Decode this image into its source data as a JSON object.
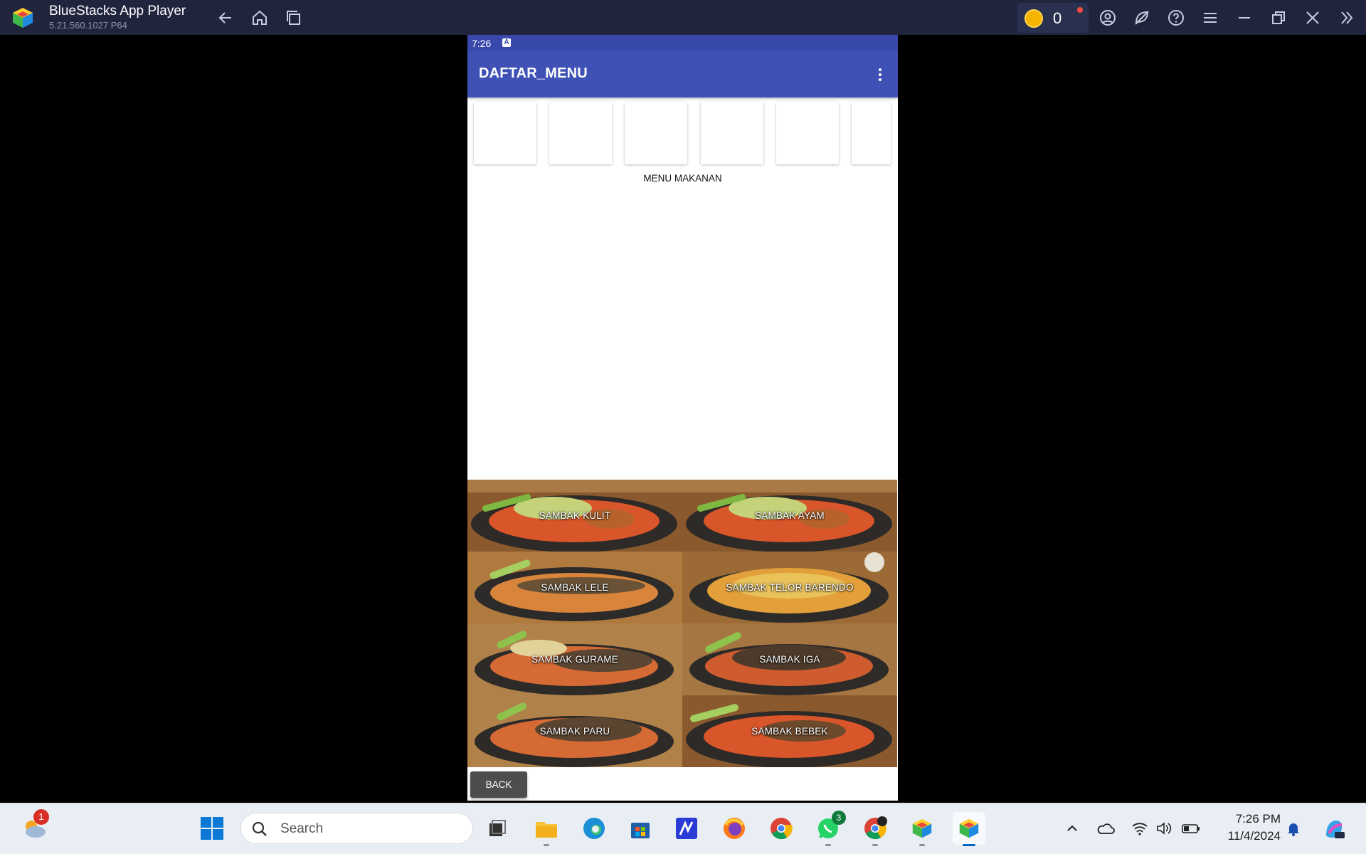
{
  "window": {
    "app_title": "BlueStacks App Player",
    "version": "5.21.560.1027  P64",
    "coin_count": "0"
  },
  "android": {
    "status_time": "7:26",
    "status_icon": "A",
    "appbar_title": "DAFTAR_MENU",
    "section_title": "MENU MAKANAN",
    "menu_items": [
      {
        "label": "SAMBAK KULIT"
      },
      {
        "label": "SAMBAK AYAM"
      },
      {
        "label": "SAMBAK LELE"
      },
      {
        "label": "SAMBAK TELOR BARENDO"
      },
      {
        "label": "SAMBAK GURAME"
      },
      {
        "label": "SAMBAK IGA"
      },
      {
        "label": "SAMBAK PARU"
      },
      {
        "label": "SAMBAK BEBEK"
      }
    ],
    "back_label": "BACK"
  },
  "taskbar": {
    "weather_badge": "1",
    "search_placeholder": "Search",
    "whatsapp_badge": "3",
    "time": "7:26 PM",
    "date": "11/4/2024"
  },
  "icons": [
    "bluestacks-logo-icon",
    "back-arrow-icon",
    "home-icon",
    "recent-apps-icon",
    "coin-icon",
    "account-icon",
    "eco-mode-icon",
    "help-icon",
    "menu-icon",
    "minimize-icon",
    "restore-icon",
    "close-icon",
    "collapse-sidebar-icon",
    "more-vert-icon"
  ],
  "colors": {
    "titlebar": "#20253d",
    "android_appbar": "#3f51b5",
    "android_statusbar": "#3949ab",
    "back_button": "#4d4d4d",
    "taskbar": "#e9edf4"
  }
}
